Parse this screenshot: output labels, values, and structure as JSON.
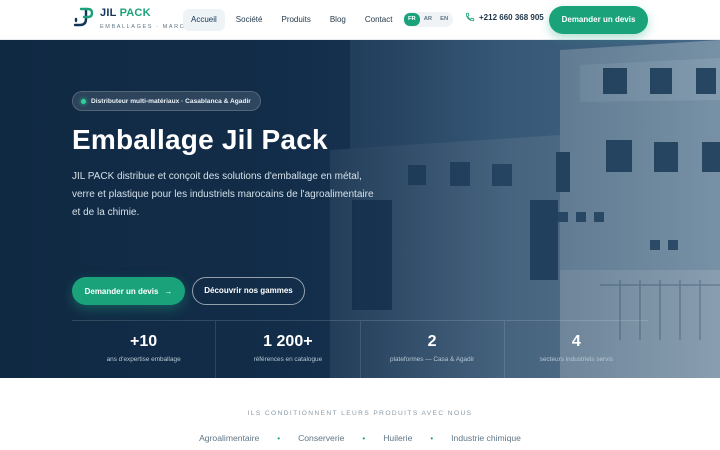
{
  "brand": {
    "name_part1": "JIL",
    "name_part2": "PACK",
    "tagline": "EMBALLAGES · MAROC"
  },
  "nav": {
    "items": [
      {
        "label": "Accueil",
        "active": true
      },
      {
        "label": "Société",
        "active": false
      },
      {
        "label": "Produits",
        "active": false
      },
      {
        "label": "Blog",
        "active": false
      },
      {
        "label": "Contact",
        "active": false
      }
    ]
  },
  "languages": [
    "FR",
    "AR",
    "EN"
  ],
  "selected_language": "FR",
  "phone": "+212 660 368 905",
  "header_cta": "Demander un devis",
  "hero": {
    "badge": "Distributeur multi-matériaux · Casablanca & Agadir",
    "title": "Emballage Jil Pack",
    "description": "JIL PACK distribue et conçoit des solutions d'emballage en métal, verre et plastique pour les industriels marocains de l'agroalimentaire et de la chimie.",
    "primary_cta": "Demander un devis",
    "secondary_cta": "Découvrir nos gammes"
  },
  "stats": [
    {
      "value": "+10",
      "label": "ans d'expertise emballage"
    },
    {
      "value": "1 200+",
      "label": "références en catalogue"
    },
    {
      "value": "2",
      "label": "plateformes — Casa & Agadir"
    },
    {
      "value": "4",
      "label": "secteurs industriels servis"
    }
  ],
  "clients": {
    "title": "ILS CONDITIONNENT LEURS PRODUITS AVEC NOUS",
    "sectors": [
      "Agroalimentaire",
      "Conserverie",
      "Huilerie",
      "Industrie chimique"
    ]
  },
  "colors": {
    "accent": "#1aa37a",
    "navy": "#12355a",
    "hero_overlay": "#102842"
  },
  "icons": [
    "logo-mark-icon",
    "phone-icon",
    "arrow-right-icon",
    "status-dot-icon"
  ]
}
